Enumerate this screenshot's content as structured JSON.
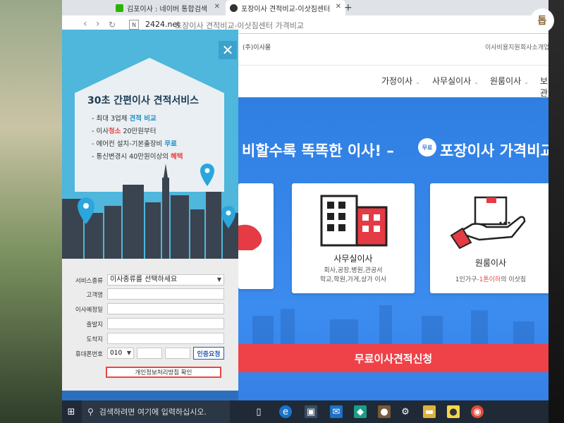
{
  "browser": {
    "tabs": [
      {
        "title": "김포이사 : 네이버 통합검색",
        "favicon_color": "#2db400"
      },
      {
        "title": "포장이사 견적비교-이삿짐센터",
        "favicon_color": "#333333"
      }
    ],
    "new_tab": "+",
    "url_host": "2424.net",
    "url_title": "포장이사 견적비교-이삿짐센터 가격비교"
  },
  "site": {
    "company": "(주)이사몰",
    "top_links": [
      "이사비용지원",
      "회사소개",
      "업"
    ],
    "main_nav": [
      "가정이사",
      "사무실이사",
      "원룸이사",
      "보관이"
    ],
    "hero_title": "비할수록 똑똑한 이사! –",
    "hero_badge": "무료",
    "hero_sub": "포장이사 가격비교 (",
    "cards": [
      {
        "title": "사무실이사",
        "desc_line1": "회사,공장,병원,관공서",
        "desc_line2": "학교,학원,가게,상가 이사"
      },
      {
        "title": "원룸이사",
        "desc_prefix": "1인가구-",
        "desc_highlight": "1톤이하",
        "desc_suffix": "의 이삿짐"
      }
    ],
    "cta_label": "무료이사견적신청"
  },
  "popup": {
    "close": "✕",
    "title": "30초 간편이사 견적서비스",
    "items": [
      {
        "prefix": "- 최대 3업체 ",
        "highlight": "견적 비교",
        "suffix": ""
      },
      {
        "prefix": "- 이사",
        "highlight": "청소",
        "suffix": " 20만원부터"
      },
      {
        "prefix": "- 에어컨 설치-기본출장비 ",
        "highlight": "무료",
        "suffix": ""
      },
      {
        "prefix": "- 통신변경시 40만원이상의 ",
        "highlight": "혜택",
        "suffix": ""
      }
    ],
    "form": {
      "service_label": "서비스종류",
      "service_value": "이사종류를 선택하세요",
      "name_label": "고객명",
      "date_label": "이사예정일",
      "from_label": "출발지",
      "to_label": "도착지",
      "phone_label": "휴대폰번호",
      "phone_prefix": "010",
      "verify_label": "인증요청",
      "privacy_label": "개인정보처리방침 확인"
    }
  },
  "taskbar": {
    "search_placeholder": "검색하려면 여기에 입력하십시오.",
    "icons": [
      "windows-icon",
      "task-view-icon",
      "edge-icon",
      "store-icon",
      "mail-icon",
      "app-icon",
      "game-icon",
      "settings-icon",
      "explorer-icon",
      "kakaotalk-icon",
      "chrome-icon"
    ]
  },
  "watermark": "톱"
}
